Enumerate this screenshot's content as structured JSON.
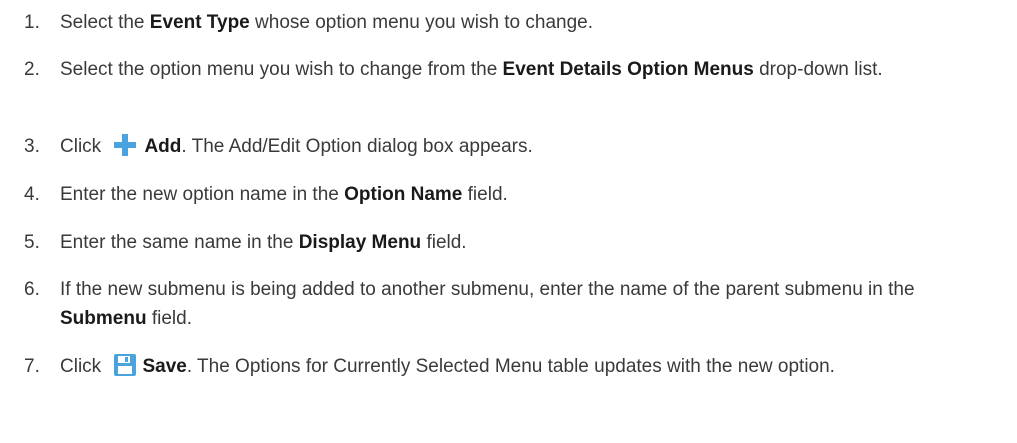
{
  "steps": [
    {
      "num": "1.",
      "parts": [
        "Select the ",
        "Event Type",
        " whose option menu you wish to change."
      ]
    },
    {
      "num": "2.",
      "parts": [
        "Select the option menu you wish to change from the ",
        "Event Details Option Menus",
        " drop-down list."
      ]
    },
    {
      "num": "3.",
      "parts": [
        "Click ",
        "Add",
        ". The Add/Edit Option dialog box appears."
      ],
      "icon": "plus-icon"
    },
    {
      "num": "4.",
      "parts": [
        "Enter the new option name in the ",
        "Option Name",
        " field."
      ]
    },
    {
      "num": "5.",
      "parts": [
        "Enter the same name in the ",
        "Display Menu",
        " field."
      ]
    },
    {
      "num": "6.",
      "parts": [
        "If the new submenu is being added to another submenu, enter the name of the parent submenu in the ",
        "Submenu",
        " field."
      ]
    },
    {
      "num": "7.",
      "parts": [
        "Click ",
        "Save",
        ". The Options for Currently Selected Menu table updates with the new option."
      ],
      "icon": "save-icon"
    }
  ],
  "colors": {
    "text": "#3a3a3a",
    "bold": "#1a1a1a",
    "icon_blue": "#4aa3df"
  }
}
